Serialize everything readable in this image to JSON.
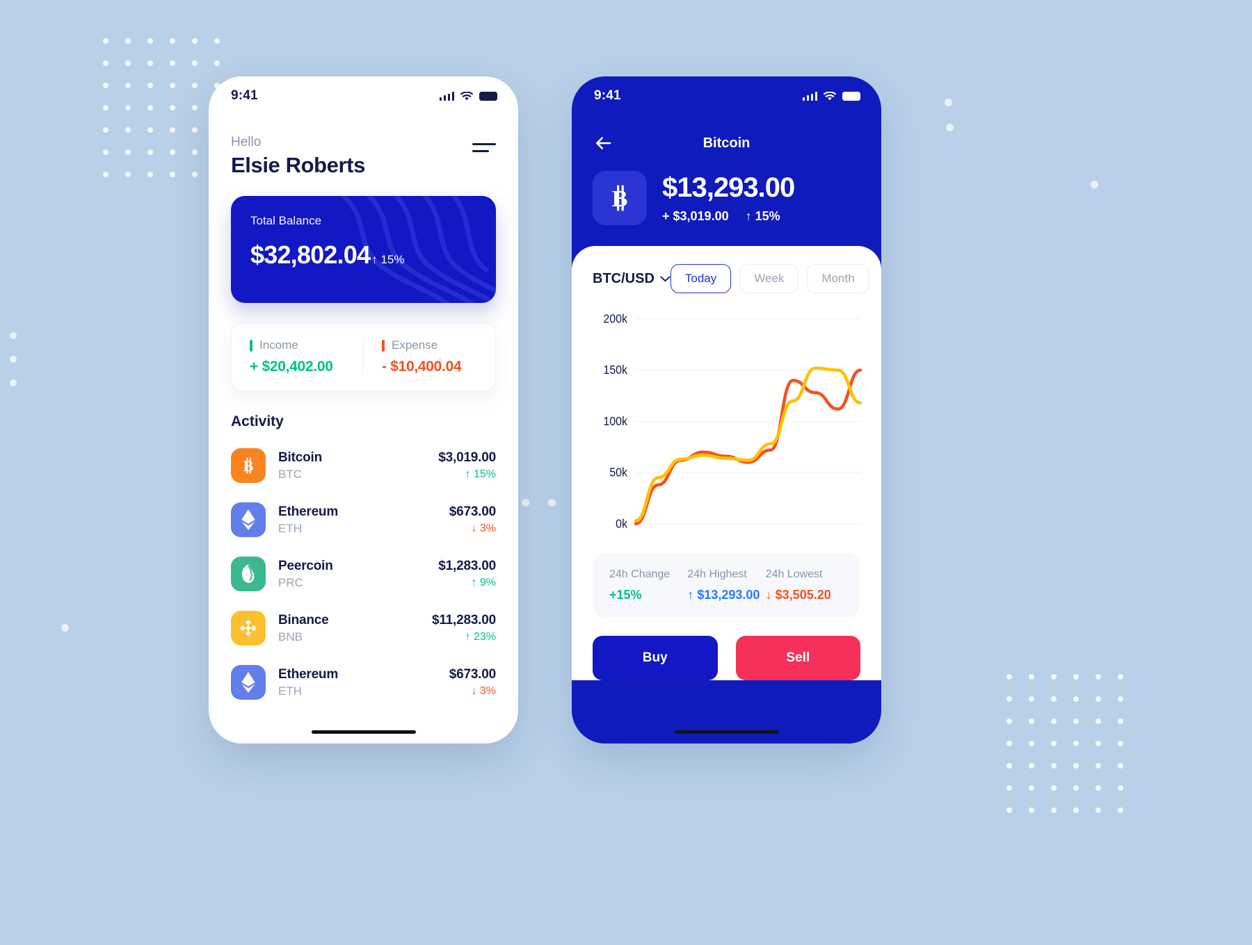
{
  "theme": {
    "bg": "#b9d0e8",
    "brand_blue": "#1118c4",
    "deep_blue": "#0f1bbd",
    "accent_blue": "#2230d8",
    "green": "#00C281",
    "red": "#F4511E",
    "pink": "#F5315B",
    "navy_text": "#151a47",
    "muted": "#8a94a6"
  },
  "left_phone": {
    "status": {
      "time": "9:41",
      "signal_icon": "cellular-bars-icon",
      "wifi_icon": "wifi-icon",
      "battery_icon": "battery-full-icon"
    },
    "greeting": "Hello",
    "user_name": "Elsie Roberts",
    "menu_icon": "hamburger-menu-icon",
    "balance_card": {
      "label": "Total Balance",
      "amount": "$32,802.04",
      "delta": "↑ 15%"
    },
    "income": {
      "label": "Income",
      "value": "+ $20,402.00",
      "color": "#00C281"
    },
    "expense": {
      "label": "Expense",
      "value": "- $10,400.04",
      "color": "#F4511E"
    },
    "activity_title": "Activity",
    "activity": [
      {
        "name": "Bitcoin",
        "symbol": "BTC",
        "price": "$3,019.00",
        "change": "15%",
        "direction": "up",
        "icon": "bitcoin-icon",
        "icon_bg": "#F7841F",
        "change_color": "#00C281"
      },
      {
        "name": "Ethereum",
        "symbol": "ETH",
        "price": "$673.00",
        "change": "3%",
        "direction": "down",
        "icon": "ethereum-icon",
        "icon_bg": "#627EEA",
        "change_color": "#F4511E"
      },
      {
        "name": "Peercoin",
        "symbol": "PRC",
        "price": "$1,283.00",
        "change": "9%",
        "direction": "up",
        "icon": "peercoin-leaf-icon",
        "icon_bg": "#3CB88C",
        "change_color": "#00C281"
      },
      {
        "name": "Binance",
        "symbol": "BNB",
        "price": "$11,283.00",
        "change": "23%",
        "direction": "up",
        "icon": "binance-icon",
        "icon_bg": "#FBC02D",
        "change_color": "#00C281"
      },
      {
        "name": "Ethereum",
        "symbol": "ETH",
        "price": "$673.00",
        "change": "3%",
        "direction": "down",
        "icon": "ethereum-icon",
        "icon_bg": "#627EEA",
        "change_color": "#F4511E"
      }
    ]
  },
  "right_phone": {
    "status": {
      "time": "9:41",
      "signal_icon": "cellular-bars-icon",
      "wifi_icon": "wifi-icon",
      "battery_icon": "battery-full-icon"
    },
    "back_icon": "back-arrow-icon",
    "title": "Bitcoin",
    "coin_icon": "bitcoin-icon",
    "price": "$13,293.00",
    "change_amount": "+ $3,019.00",
    "change_percent": "↑ 15%",
    "pair": "BTC/USD",
    "pair_chevron_icon": "chevron-down-icon",
    "ranges": [
      {
        "label": "Today",
        "active": true
      },
      {
        "label": "Week",
        "active": false
      },
      {
        "label": "Month",
        "active": false
      }
    ],
    "stats": [
      {
        "label": "24h Change",
        "value": "+15%",
        "color": "#00C281"
      },
      {
        "label": "24h Highest",
        "value": "↑ $13,293.00",
        "color": "#2979FF"
      },
      {
        "label": "24h Lowest",
        "value": "↓ $3,505.20",
        "color": "#F4511E"
      }
    ],
    "buy_button": "Buy",
    "sell_button": "Sell"
  },
  "chart_data": {
    "type": "line",
    "title": "",
    "xlabel": "",
    "ylabel": "",
    "ylim": [
      0,
      200000
    ],
    "grid": true,
    "legend": "none",
    "tick_labels": [
      "200k",
      "150k",
      "100k",
      "50k",
      "0k"
    ],
    "tick_values": [
      200000,
      150000,
      100000,
      50000,
      0
    ],
    "x": [
      0,
      1,
      2,
      3,
      4,
      5,
      6,
      7,
      8,
      9,
      10
    ],
    "series": [
      {
        "name": "series-red",
        "color": "#F4511E",
        "values": [
          0,
          38000,
          62000,
          70000,
          66000,
          60000,
          72000,
          140000,
          128000,
          112000,
          150000
        ]
      },
      {
        "name": "series-yellow",
        "color": "#FFC107",
        "values": [
          3000,
          45000,
          63000,
          67000,
          64000,
          62000,
          78000,
          120000,
          152000,
          150000,
          118000
        ]
      }
    ]
  }
}
